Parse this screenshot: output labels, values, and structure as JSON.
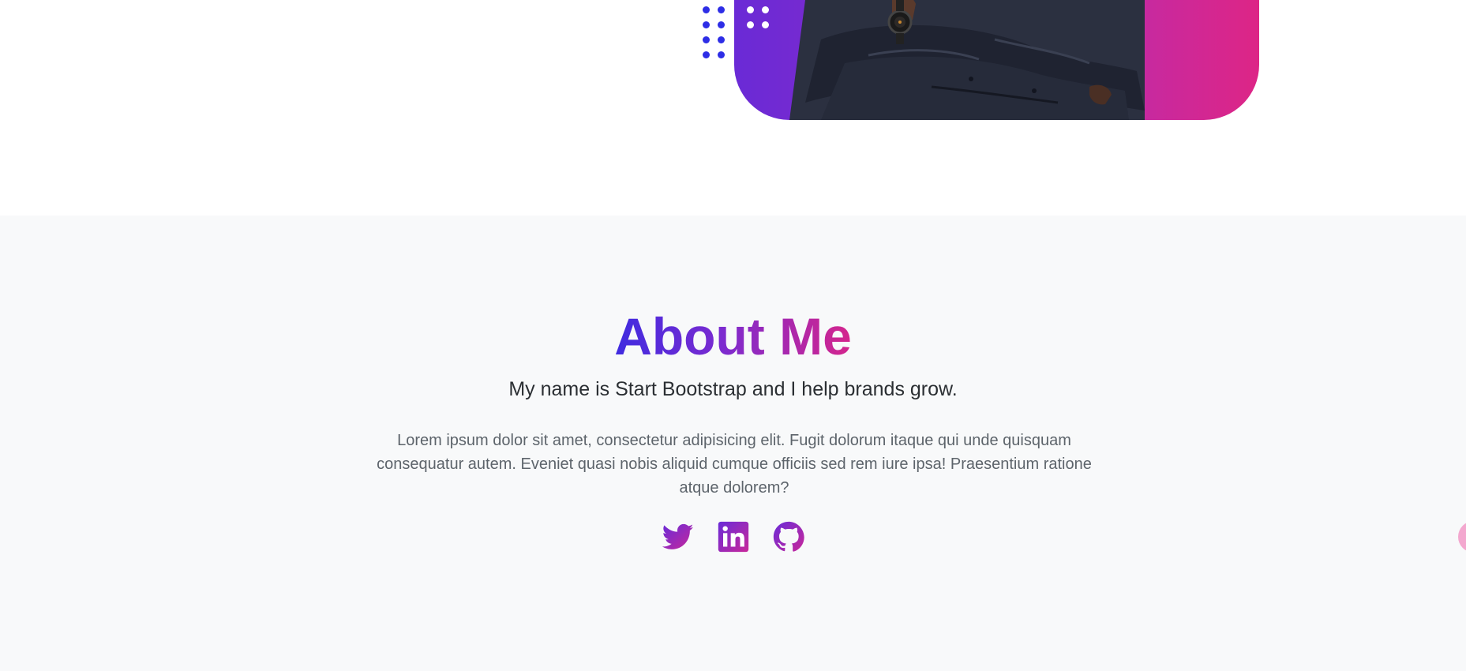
{
  "colors": {
    "gradient_start": "#3f2be0",
    "gradient_mid": "#7b2bd0",
    "gradient_end": "#d5258c",
    "dots": "#2d2de6",
    "section_bg": "#f8f9fa"
  },
  "about": {
    "title": "About Me",
    "lead": "My name is Start Bootstrap and I help brands grow.",
    "body": "Lorem ipsum dolor sit amet, consectetur adipisicing elit. Fugit dolorum itaque qui unde quisquam consequatur autem. Eveniet quasi nobis aliquid cumque officiis sed rem iure ipsa! Praesentium ratione atque dolorem?"
  },
  "socials": [
    {
      "icon": "twitter-icon"
    },
    {
      "icon": "linkedin-icon"
    },
    {
      "icon": "github-icon"
    }
  ]
}
